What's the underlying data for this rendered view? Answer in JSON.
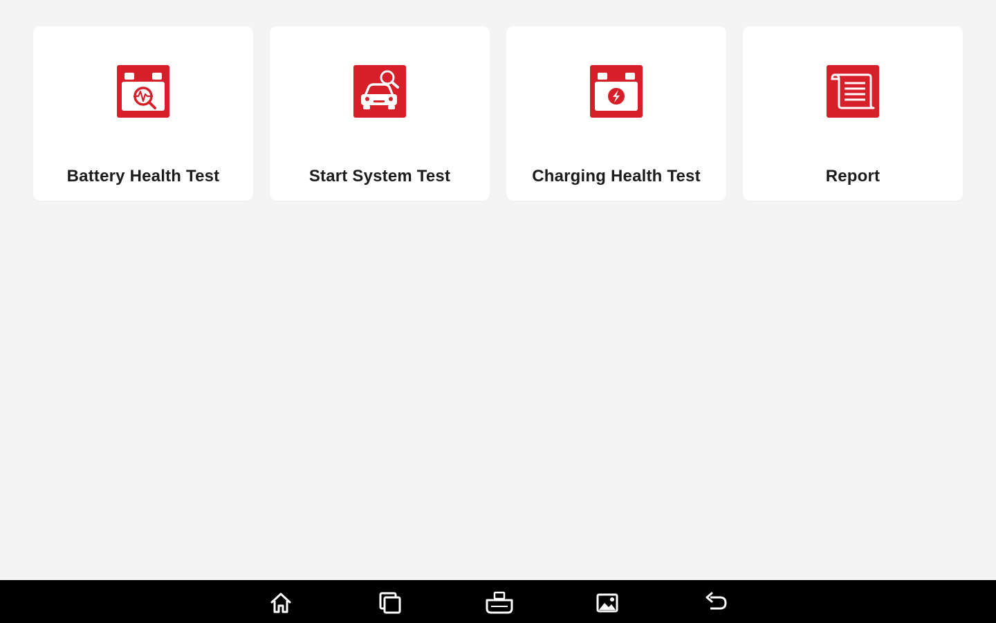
{
  "tiles": [
    {
      "label": "Battery Health Test",
      "icon": "battery-health-icon"
    },
    {
      "label": "Start System Test",
      "icon": "car-search-icon"
    },
    {
      "label": "Charging Health Test",
      "icon": "battery-charging-icon"
    },
    {
      "label": "Report",
      "icon": "report-document-icon"
    }
  ],
  "navbar": {
    "buttons": [
      "home-icon",
      "recent-apps-icon",
      "vci-connector-icon",
      "gallery-icon",
      "back-icon"
    ]
  },
  "colors": {
    "accent": "#d71f2a",
    "background": "#f4f4f4",
    "tile": "#ffffff",
    "navbar": "#000000"
  }
}
